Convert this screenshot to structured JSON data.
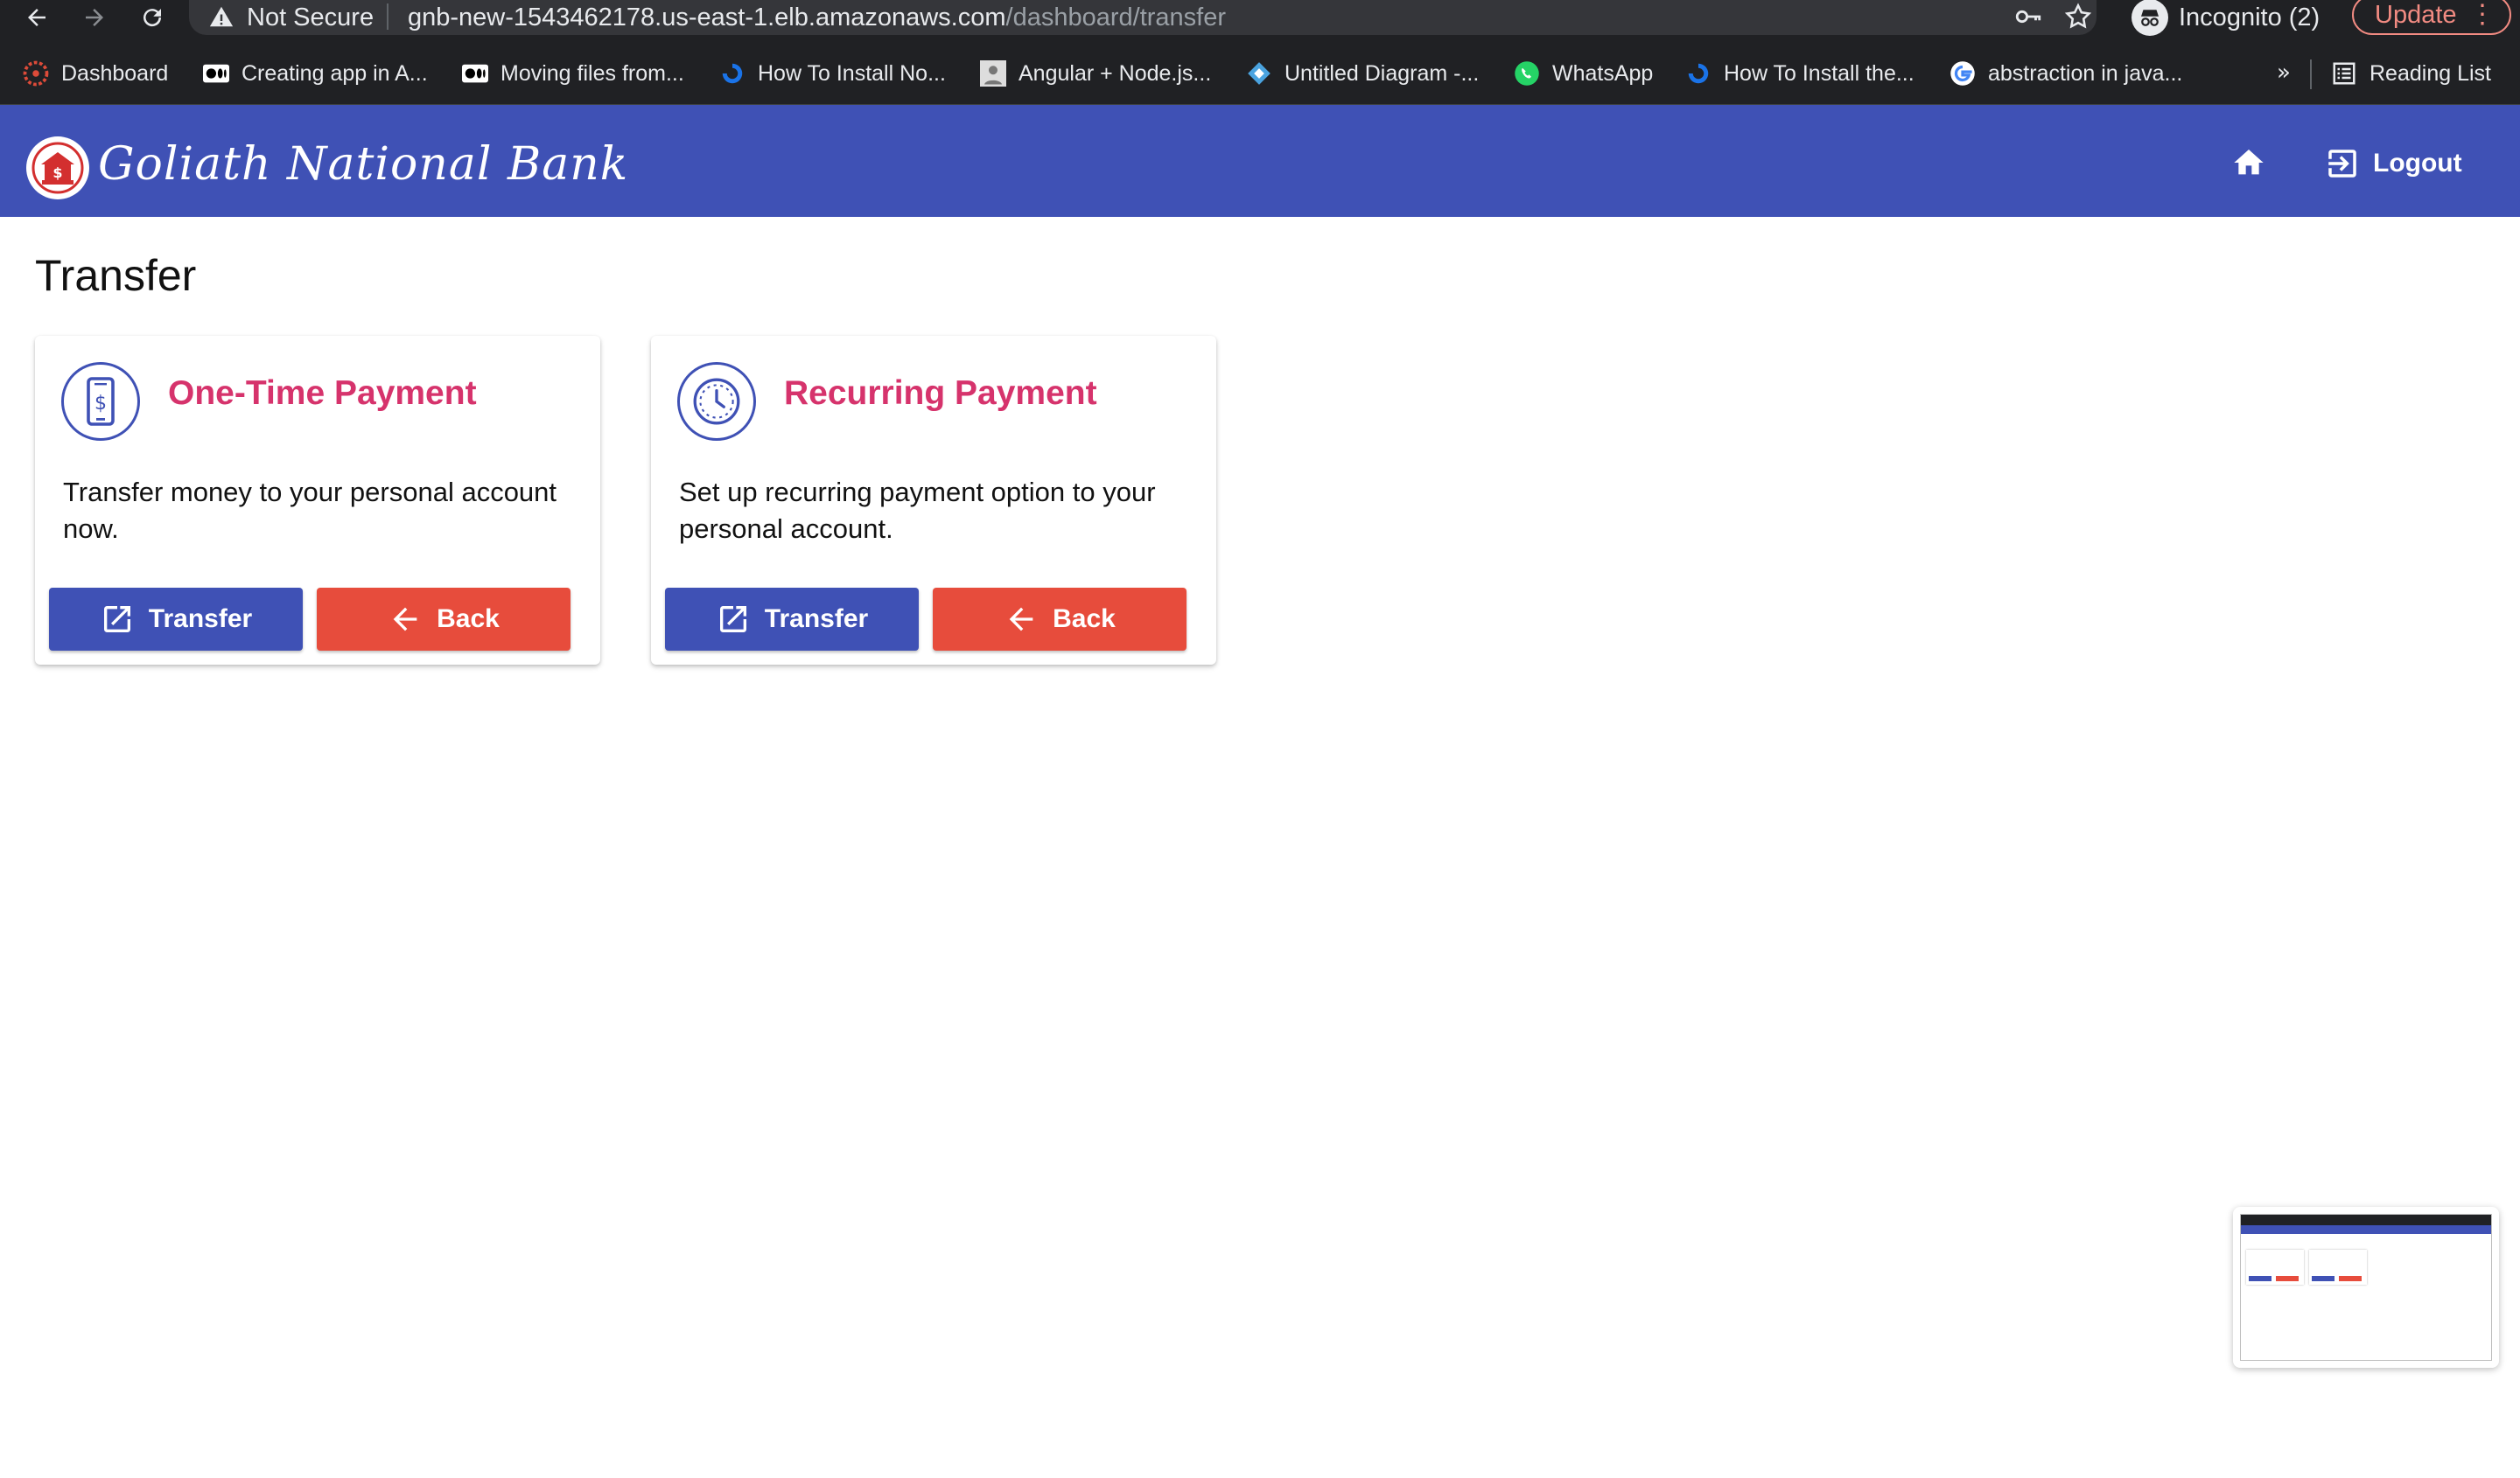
{
  "browser": {
    "security_label": "Not Secure",
    "url_host": "gnb-new-1543462178.us-east-1.elb.amazonaws.com",
    "url_path": "/dashboard/transfer",
    "incognito_label": "Incognito (2)",
    "update_label": "Update",
    "bookmarks": [
      {
        "label": "Dashboard",
        "icon": "angular-icon"
      },
      {
        "label": "Creating app in A...",
        "icon": "medium-icon"
      },
      {
        "label": "Moving files from...",
        "icon": "medium-icon"
      },
      {
        "label": "How To Install No...",
        "icon": "digitalocean-icon"
      },
      {
        "label": "Angular + Node.js...",
        "icon": "avatar-icon"
      },
      {
        "label": "Untitled Diagram -...",
        "icon": "diagram-icon"
      },
      {
        "label": "WhatsApp",
        "icon": "whatsapp-icon"
      },
      {
        "label": "How To Install the...",
        "icon": "digitalocean-icon"
      },
      {
        "label": "abstraction in java...",
        "icon": "google-icon"
      }
    ],
    "bookmarks_overflow": "»",
    "reading_list_label": "Reading List"
  },
  "header": {
    "brand": "Goliath National Bank",
    "logout_label": "Logout",
    "accent_color": "#3f51b5"
  },
  "page": {
    "title": "Transfer",
    "cards": [
      {
        "title": "One-Time Payment",
        "description": "Transfer money to your personal account now.",
        "icon": "phone-dollar-icon",
        "primary_label": "Transfer",
        "secondary_label": "Back"
      },
      {
        "title": "Recurring Payment",
        "description": "Set up recurring payment option to your personal account.",
        "icon": "clock-icon",
        "primary_label": "Transfer",
        "secondary_label": "Back"
      }
    ],
    "title_color": "#d6336c",
    "primary_color": "#3f51b5",
    "danger_color": "#e74c3c"
  }
}
